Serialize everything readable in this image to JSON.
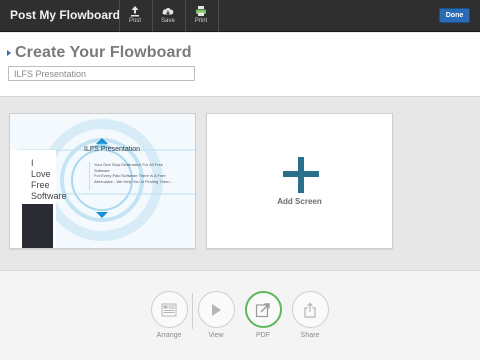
{
  "topbar": {
    "app_title": "Post My Flowboard",
    "buttons": [
      {
        "label": "Post",
        "icon": "upload-icon"
      },
      {
        "label": "Save",
        "icon": "cloud-save-icon"
      },
      {
        "label": "Print",
        "icon": "printer-icon"
      }
    ],
    "done_label": "Done"
  },
  "header": {
    "title": "Create Your Flowboard",
    "flowboard_name": "ILFS Presentation"
  },
  "screens": [
    {
      "title": "ILFS Presentation",
      "side_words": [
        "I",
        "Love",
        "Free",
        "Software"
      ],
      "body_lines": [
        "Your One Stop Destination For All Free Software",
        "For Every Paid Software There Is A Free Alternative - We Help You In Finding Them..."
      ]
    }
  ],
  "add_screen_label": "Add Screen",
  "bottom_toolbar": [
    {
      "label": "Arrange",
      "icon": "arrange-icon",
      "active": false
    },
    {
      "label": "View",
      "icon": "play-icon",
      "active": false
    },
    {
      "label": "PDF",
      "icon": "pdf-export-icon",
      "active": true
    },
    {
      "label": "Share",
      "icon": "share-icon",
      "active": false
    }
  ],
  "colors": {
    "topbar_bg": "#2f2f2f",
    "accent_blue": "#2a6bb5",
    "plus_teal": "#2a6f8c",
    "active_green": "#5cb85c"
  }
}
